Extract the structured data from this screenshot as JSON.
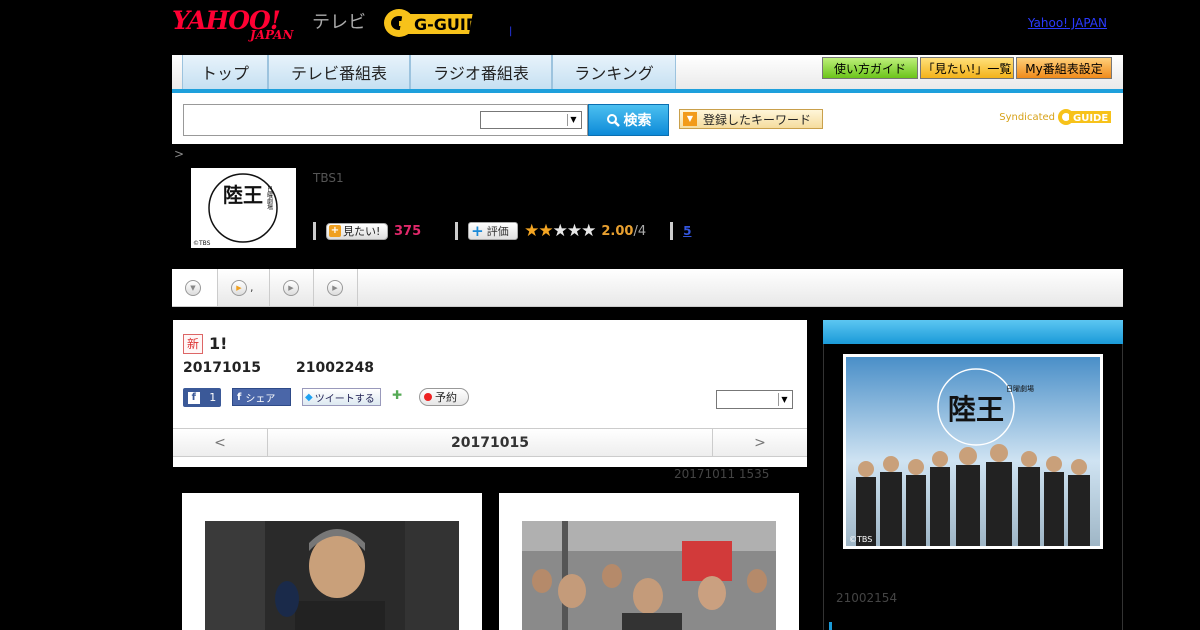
{
  "header": {
    "logo_yahoo": "YAHOO!",
    "logo_japan": "JAPAN",
    "logo_tv": "テレビ",
    "logo_gguide": "G-GUIDE",
    "yahoo_japan_link": "Yahoo! JAPAN",
    "dot": "|"
  },
  "nav": {
    "tabs": [
      {
        "label": "トップ"
      },
      {
        "label": "テレビ番組表"
      },
      {
        "label": "ラジオ番組表"
      },
      {
        "label": "ランキング"
      }
    ],
    "guide_button": "使い方ガイド",
    "want_list_button": "「見たい!」一覧",
    "my_schedule_button": "My番組表設定"
  },
  "search": {
    "button_label": "検索",
    "keyword_button": "登録したキーワード",
    "syndicated": "Syndicated",
    "syndicated_logo": "GUIDE"
  },
  "breadcrumb": ">",
  "program": {
    "channel": "TBS1",
    "thumb_title": "陸王",
    "thumb_sub": "日曜劇場",
    "thumb_copyright": "©TBS",
    "want_label": "見たい!",
    "want_count": "375",
    "rate_label": "評価",
    "rating_stars": 2,
    "rating_max_stars": 5,
    "score": "2.00",
    "score_max": "/4",
    "review_count": "5"
  },
  "tabs": {
    "tab2_text": ","
  },
  "episode": {
    "new_badge": "新",
    "title": "1!",
    "date": "20171015",
    "code": "21002248",
    "like_count": "1",
    "share_label": "シェア",
    "tweet_label": "ツイートする",
    "reserve_label": "予約",
    "prev": "<",
    "center_date": "20171015",
    "next": ">"
  },
  "updated_text": "20171011  1535",
  "sidebar": {
    "photo_title": "陸王",
    "photo_sub": "日曜劇場",
    "photo_copyright": "©TBS",
    "code": "21002154"
  },
  "colors": {
    "accent": "#1ea0dc",
    "star": "#f5a623",
    "want_count": "#e0286a"
  }
}
